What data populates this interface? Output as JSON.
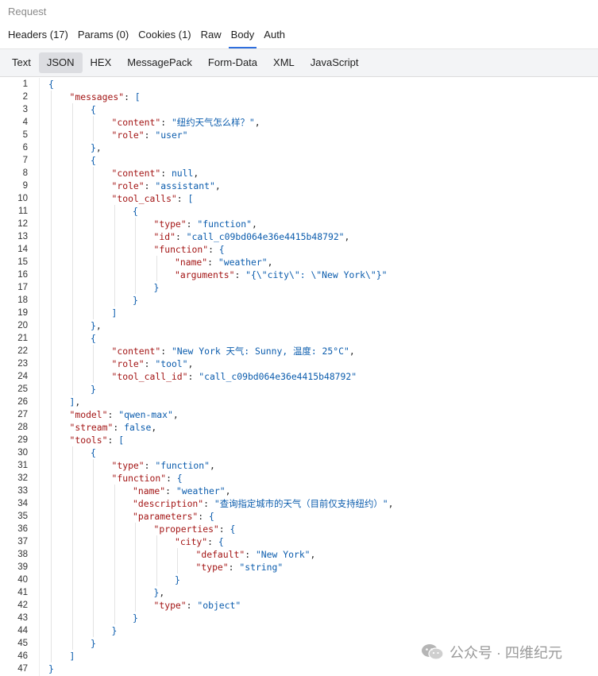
{
  "header": {
    "title": "Request"
  },
  "tabs": [
    "Headers (17)",
    "Params (0)",
    "Cookies (1)",
    "Raw",
    "Body",
    "Auth"
  ],
  "active_tab": "Body",
  "subtabs": [
    "Text",
    "JSON",
    "HEX",
    "MessagePack",
    "Form-Data",
    "XML",
    "JavaScript"
  ],
  "active_subtab": "JSON",
  "watermark": {
    "text": "公众号 · 四维纪元",
    "icon": "wechat-icon"
  },
  "code_lines": [
    [
      0,
      [
        [
          "b",
          "{"
        ]
      ]
    ],
    [
      1,
      [
        [
          "k",
          "\"messages\""
        ],
        [
          "p",
          ": "
        ],
        [
          "b",
          "["
        ]
      ]
    ],
    [
      2,
      [
        [
          "b",
          "{"
        ]
      ]
    ],
    [
      3,
      [
        [
          "k",
          "\"content\""
        ],
        [
          "p",
          ": "
        ],
        [
          "s",
          "\"纽约天气怎么样？\""
        ],
        [
          "p",
          ","
        ]
      ]
    ],
    [
      3,
      [
        [
          "k",
          "\"role\""
        ],
        [
          "p",
          ": "
        ],
        [
          "s",
          "\"user\""
        ]
      ]
    ],
    [
      2,
      [
        [
          "b",
          "}"
        ],
        [
          "p",
          ","
        ]
      ]
    ],
    [
      2,
      [
        [
          "b",
          "{"
        ]
      ]
    ],
    [
      3,
      [
        [
          "k",
          "\"content\""
        ],
        [
          "p",
          ": "
        ],
        [
          "n",
          "null"
        ],
        [
          "p",
          ","
        ]
      ]
    ],
    [
      3,
      [
        [
          "k",
          "\"role\""
        ],
        [
          "p",
          ": "
        ],
        [
          "s",
          "\"assistant\""
        ],
        [
          "p",
          ","
        ]
      ]
    ],
    [
      3,
      [
        [
          "k",
          "\"tool_calls\""
        ],
        [
          "p",
          ": "
        ],
        [
          "b",
          "["
        ]
      ]
    ],
    [
      4,
      [
        [
          "b",
          "{"
        ]
      ]
    ],
    [
      5,
      [
        [
          "k",
          "\"type\""
        ],
        [
          "p",
          ": "
        ],
        [
          "s",
          "\"function\""
        ],
        [
          "p",
          ","
        ]
      ]
    ],
    [
      5,
      [
        [
          "k",
          "\"id\""
        ],
        [
          "p",
          ": "
        ],
        [
          "s",
          "\"call_c09bd064e36e4415b48792\""
        ],
        [
          "p",
          ","
        ]
      ]
    ],
    [
      5,
      [
        [
          "k",
          "\"function\""
        ],
        [
          "p",
          ": "
        ],
        [
          "b",
          "{"
        ]
      ]
    ],
    [
      6,
      [
        [
          "k",
          "\"name\""
        ],
        [
          "p",
          ": "
        ],
        [
          "s",
          "\"weather\""
        ],
        [
          "p",
          ","
        ]
      ]
    ],
    [
      6,
      [
        [
          "k",
          "\"arguments\""
        ],
        [
          "p",
          ": "
        ],
        [
          "s",
          "\"{\\\"city\\\": \\\"New York\\\"}\""
        ]
      ]
    ],
    [
      5,
      [
        [
          "b",
          "}"
        ]
      ]
    ],
    [
      4,
      [
        [
          "b",
          "}"
        ]
      ]
    ],
    [
      3,
      [
        [
          "b",
          "]"
        ]
      ]
    ],
    [
      2,
      [
        [
          "b",
          "}"
        ],
        [
          "p",
          ","
        ]
      ]
    ],
    [
      2,
      [
        [
          "b",
          "{"
        ]
      ]
    ],
    [
      3,
      [
        [
          "k",
          "\"content\""
        ],
        [
          "p",
          ": "
        ],
        [
          "s",
          "\"New York 天气: Sunny, 温度: 25°C\""
        ],
        [
          "p",
          ","
        ]
      ]
    ],
    [
      3,
      [
        [
          "k",
          "\"role\""
        ],
        [
          "p",
          ": "
        ],
        [
          "s",
          "\"tool\""
        ],
        [
          "p",
          ","
        ]
      ]
    ],
    [
      3,
      [
        [
          "k",
          "\"tool_call_id\""
        ],
        [
          "p",
          ": "
        ],
        [
          "s",
          "\"call_c09bd064e36e4415b48792\""
        ]
      ]
    ],
    [
      2,
      [
        [
          "b",
          "}"
        ]
      ]
    ],
    [
      1,
      [
        [
          "b",
          "]"
        ],
        [
          "p",
          ","
        ]
      ]
    ],
    [
      1,
      [
        [
          "k",
          "\"model\""
        ],
        [
          "p",
          ": "
        ],
        [
          "s",
          "\"qwen-max\""
        ],
        [
          "p",
          ","
        ]
      ]
    ],
    [
      1,
      [
        [
          "k",
          "\"stream\""
        ],
        [
          "p",
          ": "
        ],
        [
          "n",
          "false"
        ],
        [
          "p",
          ","
        ]
      ]
    ],
    [
      1,
      [
        [
          "k",
          "\"tools\""
        ],
        [
          "p",
          ": "
        ],
        [
          "b",
          "["
        ]
      ]
    ],
    [
      2,
      [
        [
          "b",
          "{"
        ]
      ]
    ],
    [
      3,
      [
        [
          "k",
          "\"type\""
        ],
        [
          "p",
          ": "
        ],
        [
          "s",
          "\"function\""
        ],
        [
          "p",
          ","
        ]
      ]
    ],
    [
      3,
      [
        [
          "k",
          "\"function\""
        ],
        [
          "p",
          ": "
        ],
        [
          "b",
          "{"
        ]
      ]
    ],
    [
      4,
      [
        [
          "k",
          "\"name\""
        ],
        [
          "p",
          ": "
        ],
        [
          "s",
          "\"weather\""
        ],
        [
          "p",
          ","
        ]
      ]
    ],
    [
      4,
      [
        [
          "k",
          "\"description\""
        ],
        [
          "p",
          ": "
        ],
        [
          "s",
          "\"查询指定城市的天气（目前仅支持纽约）\""
        ],
        [
          "p",
          ","
        ]
      ]
    ],
    [
      4,
      [
        [
          "k",
          "\"parameters\""
        ],
        [
          "p",
          ": "
        ],
        [
          "b",
          "{"
        ]
      ]
    ],
    [
      5,
      [
        [
          "k",
          "\"properties\""
        ],
        [
          "p",
          ": "
        ],
        [
          "b",
          "{"
        ]
      ]
    ],
    [
      6,
      [
        [
          "k",
          "\"city\""
        ],
        [
          "p",
          ": "
        ],
        [
          "b",
          "{"
        ]
      ]
    ],
    [
      7,
      [
        [
          "k",
          "\"default\""
        ],
        [
          "p",
          ": "
        ],
        [
          "s",
          "\"New York\""
        ],
        [
          "p",
          ","
        ]
      ]
    ],
    [
      7,
      [
        [
          "k",
          "\"type\""
        ],
        [
          "p",
          ": "
        ],
        [
          "s",
          "\"string\""
        ]
      ]
    ],
    [
      6,
      [
        [
          "b",
          "}"
        ]
      ]
    ],
    [
      5,
      [
        [
          "b",
          "}"
        ],
        [
          "p",
          ","
        ]
      ]
    ],
    [
      5,
      [
        [
          "k",
          "\"type\""
        ],
        [
          "p",
          ": "
        ],
        [
          "s",
          "\"object\""
        ]
      ]
    ],
    [
      4,
      [
        [
          "b",
          "}"
        ]
      ]
    ],
    [
      3,
      [
        [
          "b",
          "}"
        ]
      ]
    ],
    [
      2,
      [
        [
          "b",
          "}"
        ]
      ]
    ],
    [
      1,
      [
        [
          "b",
          "]"
        ]
      ]
    ],
    [
      0,
      [
        [
          "b",
          "}"
        ]
      ]
    ]
  ]
}
